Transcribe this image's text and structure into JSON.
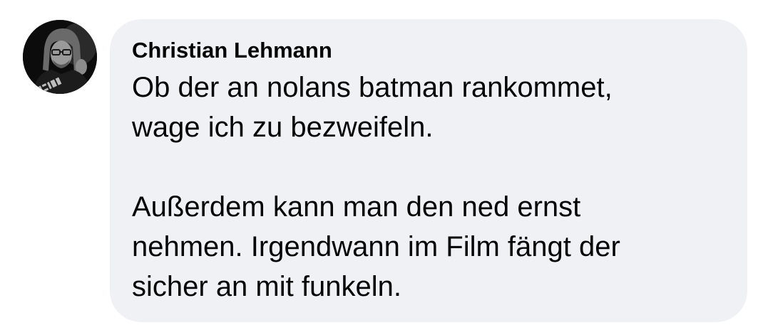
{
  "comment": {
    "author": "Christian Lehmann",
    "avatar_icon": "profile-photo-avatar",
    "paragraphs": [
      {
        "lines": [
          "Ob der an nolans batman rankommet,",
          "wage ich zu bezweifeln."
        ]
      },
      {
        "lines": [
          "Außerdem kann man den ned ernst",
          "nehmen. Irgendwann im Film fängt der",
          "sicher an mit funkeln."
        ]
      }
    ]
  },
  "colors": {
    "bubble_background": "#f0f1f5",
    "text": "#050505",
    "page_background": "#ffffff"
  }
}
